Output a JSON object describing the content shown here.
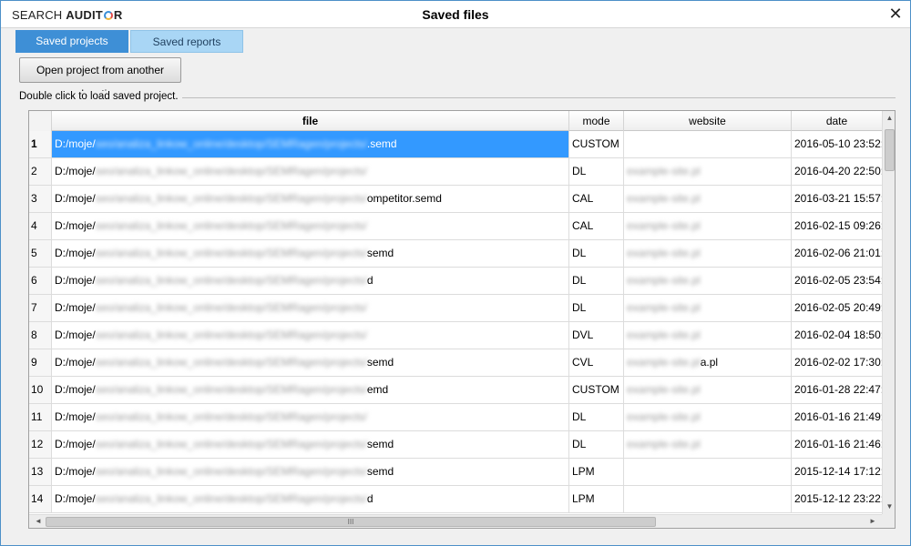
{
  "window": {
    "brand_prefix": "SEARCH ",
    "brand_bold_1": "AUDIT",
    "brand_bold_2": "R",
    "title": "Saved files",
    "close_symbol": "✕"
  },
  "tabs": [
    {
      "label": "Saved projects",
      "active": true
    },
    {
      "label": "Saved reports",
      "active": false
    }
  ],
  "actions": {
    "open_other_location": "Open project from another location"
  },
  "hint": "Double click to load saved project.",
  "table": {
    "columns": {
      "file": "file",
      "mode": "mode",
      "website": "website",
      "date": "date"
    },
    "rows": [
      {
        "num": "1",
        "file_visible": "D:/moje/",
        "file_tail": ".semd",
        "mode": "CUSTOM",
        "website": "",
        "date": "2016-05-10 23:52:",
        "selected": true
      },
      {
        "num": "2",
        "file_visible": "D:/moje/",
        "file_tail": "",
        "mode": "DL",
        "website": "",
        "date": "2016-04-20 22:50:"
      },
      {
        "num": "3",
        "file_visible": "D:/moje/",
        "file_tail": "ompetitor.semd",
        "mode": "CAL",
        "website": "",
        "date": "2016-03-21 15:57:"
      },
      {
        "num": "4",
        "file_visible": "D:/moje/",
        "file_tail": "",
        "mode": "CAL",
        "website": "",
        "date": "2016-02-15 09:26:"
      },
      {
        "num": "5",
        "file_visible": "D:/moje/",
        "file_tail": "semd",
        "mode": "DL",
        "website": "",
        "date": "2016-02-06 21:01:"
      },
      {
        "num": "6",
        "file_visible": "D:/moje/",
        "file_tail": "d",
        "mode": "DL",
        "website": "",
        "date": "2016-02-05 23:54:"
      },
      {
        "num": "7",
        "file_visible": "D:/moje/",
        "file_tail": "",
        "mode": "DL",
        "website": "",
        "date": "2016-02-05 20:49:"
      },
      {
        "num": "8",
        "file_visible": "D:/moje/",
        "file_tail": "",
        "mode": "DVL",
        "website": "",
        "date": "2016-02-04 18:50:"
      },
      {
        "num": "9",
        "file_visible": "D:/moje/",
        "file_tail": "semd",
        "mode": "CVL",
        "website": "a.pl",
        "date": "2016-02-02 17:30:"
      },
      {
        "num": "10",
        "file_visible": "D:/moje/",
        "file_tail": "emd",
        "mode": "CUSTOM",
        "website": "",
        "date": "2016-01-28 22:47:"
      },
      {
        "num": "11",
        "file_visible": "D:/moje/",
        "file_tail": "",
        "mode": "DL",
        "website": "",
        "date": "2016-01-16 21:49:"
      },
      {
        "num": "12",
        "file_visible": "D:/moje/",
        "file_tail": "semd",
        "mode": "DL",
        "website": "",
        "date": "2016-01-16 21:46:"
      },
      {
        "num": "13",
        "file_visible": "D:/moje/",
        "file_tail": "semd",
        "mode": "LPM",
        "website": "",
        "date": "2015-12-14 17:12:"
      },
      {
        "num": "14",
        "file_visible": "D:/moje/",
        "file_tail": "d",
        "mode": "LPM",
        "website": "",
        "date": "2015-12-12 23:22:"
      }
    ]
  },
  "scrollbars": {
    "up_symbol": "▲",
    "down_symbol": "▼",
    "left_symbol": "◄",
    "right_symbol": "►",
    "grip_symbol": "III"
  }
}
